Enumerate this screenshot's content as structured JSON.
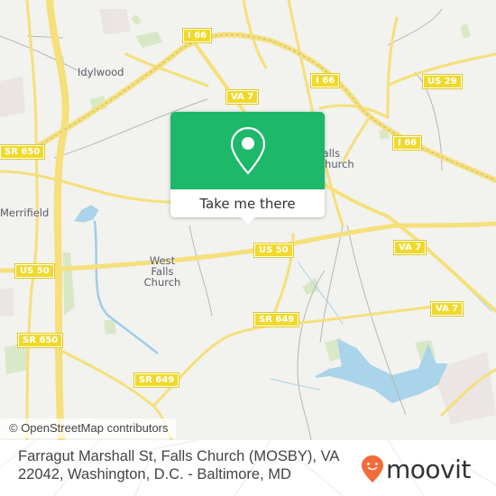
{
  "map": {
    "road_shields": [
      {
        "id": "i66-nw",
        "label": "I 66"
      },
      {
        "id": "i66-n",
        "label": "I 66"
      },
      {
        "id": "i66-e",
        "label": "I 66"
      },
      {
        "id": "us29",
        "label": "US 29"
      },
      {
        "id": "va7-n",
        "label": "VA 7"
      },
      {
        "id": "sr650-n",
        "label": "SR 650"
      },
      {
        "id": "us50-w",
        "label": "US 50"
      },
      {
        "id": "us50-c",
        "label": "US 50"
      },
      {
        "id": "va7-e",
        "label": "VA 7"
      },
      {
        "id": "va7-se",
        "label": "VA 7"
      },
      {
        "id": "sr649-c",
        "label": "SR 649"
      },
      {
        "id": "sr650-s",
        "label": "SR 650"
      },
      {
        "id": "sr649-s",
        "label": "SR 649"
      }
    ],
    "places": [
      {
        "id": "idylwood",
        "label": "Idylwood"
      },
      {
        "id": "merrifield",
        "label": "Merrifield"
      },
      {
        "id": "west-falls-church",
        "lines": [
          "West",
          "Falls",
          "Church"
        ]
      },
      {
        "id": "falls-church",
        "lines": [
          "Falls",
          "Church"
        ]
      }
    ],
    "attribution": "© OpenStreetMap contributors"
  },
  "popup": {
    "icon": "map-pin-icon",
    "button_label": "Take me there",
    "color": "#1db86a"
  },
  "footer": {
    "address": "Farragut Marshall St, Falls Church (MOSBY), VA 22042, Washington, D.C. - Baltimore, MD",
    "logo_text": "moovit",
    "logo_color": "#f26b3a"
  }
}
